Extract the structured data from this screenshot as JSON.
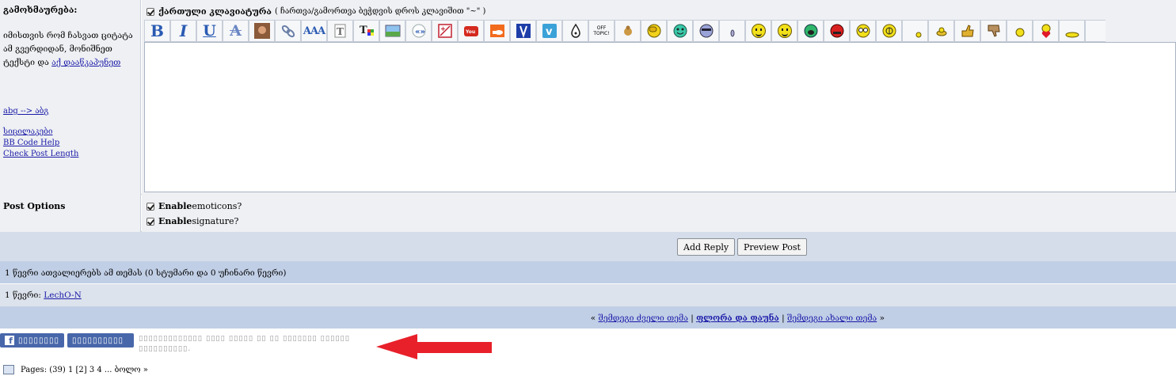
{
  "left": {
    "label": "გამოხმაურება:",
    "hint_text": "იმისთვის რომ ჩასვათ ციტატა ამ გვერდიდან, მონიშნეთ ტექსტი და",
    "hint_link": "აქ დააწკაპუნეთ",
    "translit_link": "abg --> აბგ",
    "smilies_link": "სიცილაკები",
    "bbcode_link": "BB Code Help",
    "length_link": "Check Post Length"
  },
  "keyboard": {
    "label": "ქართული კლავიატურა",
    "note": "( ჩართვა/გამორთვა ბეჭდვის დროს კლავიშით \"~\" )"
  },
  "toolbar": {
    "bold": "B",
    "italic": "I",
    "underline": "U",
    "strike": "A",
    "font": "AAA",
    "offtopic": "OFF TOPIC!"
  },
  "options": {
    "label": "Post Options",
    "emoticons_bold": "Enable",
    "emoticons_rest": " emoticons?",
    "signature_bold": "Enable",
    "signature_rest": " signature?"
  },
  "buttons": {
    "add_reply": "Add Reply",
    "preview": "Preview Post"
  },
  "viewers": {
    "summary": "1 წევრი ათვალიერებს ამ თემას (0 სტუმარი და 0 უჩინარი წევრი)",
    "members_label": "1 წევრი: ",
    "member_name": "LechO-N"
  },
  "nav": {
    "open": "« ",
    "older": "შემდეგი ძველი თემა",
    "sep": " | ",
    "current": "ფლორა და ფაუნა",
    "newer": "შემდეგი ახალი თემა",
    "close": " »"
  },
  "social": {
    "fb_btn1": "▯▯▯▯▯▯▯▯",
    "fb_btn2": "▯▯▯▯▯▯▯▯▯▯",
    "text": "▯▯▯▯▯▯▯▯▯▯▯▯▯ ▯▯▯▯ ▯▯▯▯▯ ▯▯ ▯▯ ▯▯▯▯▯▯▯ ▯▯▯▯▯▯ ▯▯▯▯▯▯▯▯▯▯."
  },
  "pages": {
    "text": "Pages: (39) 1 [2] 3 4 ... ბოლო »"
  },
  "colors": {
    "arrow": "#e8202a",
    "fb": "#4867aa",
    "link": "#1a1aa8"
  }
}
